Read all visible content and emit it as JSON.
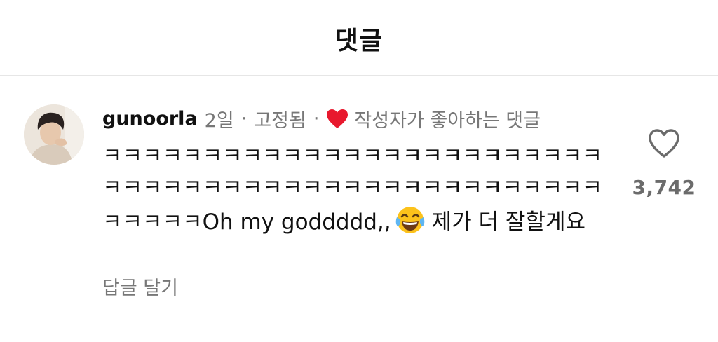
{
  "header": {
    "title": "댓글"
  },
  "comment": {
    "username": "gunoorla",
    "time": "2일",
    "separator": "·",
    "pinned": "고정됨",
    "author_liked_label": "작성자가 좋아하는 댓글",
    "author_liked_color": "#e8182d",
    "text_part1": "ㅋㅋㅋㅋㅋㅋㅋㅋㅋㅋㅋㅋㅋㅋㅋㅋㅋㅋㅋㅋㅋㅋㅋㅋㅋㅋㅋㅋㅋㅋㅋㅋㅋㅋㅋㅋㅋㅋㅋㅋㅋㅋㅋㅋㅋㅋㅋㅋㅋㅋㅋㅋㅋㅋㅋOh my goddddd,,",
    "emoji": "tears-of-joy-emoji",
    "text_part2": "제가 더 잘할게요",
    "reply_label": "답글 달기",
    "like_icon": "heart-outline-icon",
    "like_count": "3,742"
  }
}
